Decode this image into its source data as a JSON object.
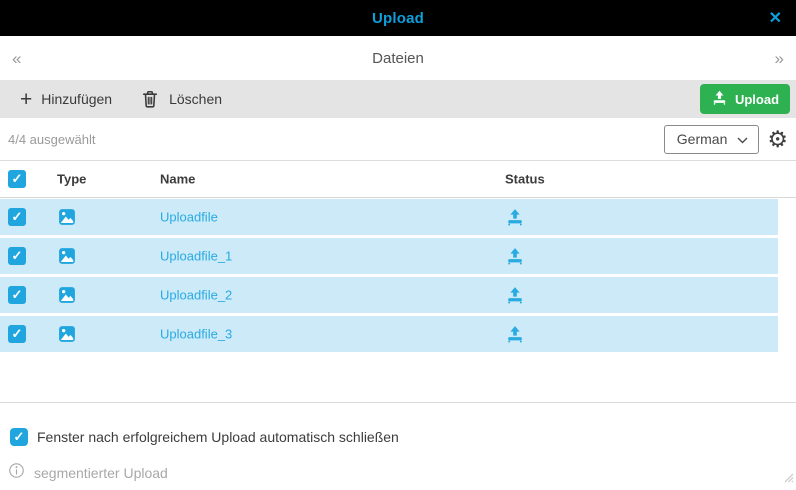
{
  "titlebar": {
    "title": "Upload",
    "close_icon": "✕"
  },
  "nav": {
    "prev_icon": "«",
    "next_icon": "»",
    "title": "Dateien"
  },
  "toolbar": {
    "add_icon": "+",
    "add_label": "Hinzufügen",
    "delete_label": "Löschen",
    "upload_label": "Upload"
  },
  "selection_bar": {
    "selected_text": "4/4 ausgewählt",
    "language_value": "German",
    "gear_icon": "⚙"
  },
  "table": {
    "header": {
      "type": "Type",
      "name": "Name",
      "status": "Status"
    },
    "rows": [
      {
        "name": "Uploadfile",
        "type_icon": "image-icon",
        "status_icon": "upload-icon",
        "checked": true
      },
      {
        "name": "Uploadfile_1",
        "type_icon": "image-icon",
        "status_icon": "upload-icon",
        "checked": true
      },
      {
        "name": "Uploadfile_2",
        "type_icon": "image-icon",
        "status_icon": "upload-icon",
        "checked": true
      },
      {
        "name": "Uploadfile_3",
        "type_icon": "image-icon",
        "status_icon": "upload-icon",
        "checked": true
      }
    ]
  },
  "footer": {
    "autoclose_label": "Fenster nach erfolgreichem Upload automatisch schließen",
    "autoclose_checked": true,
    "segmented_info_label": "segmentierter Upload"
  },
  "icons": {
    "check_glyph": "✓"
  },
  "colors": {
    "accent": "#21a5de",
    "link": "#29abe2",
    "green": "#2eb150",
    "row_bg": "#cdeaf8",
    "toolbar_bg": "#e4e4e4",
    "titlebar_bg": "#000000",
    "title_text": "#0c9fdb"
  }
}
